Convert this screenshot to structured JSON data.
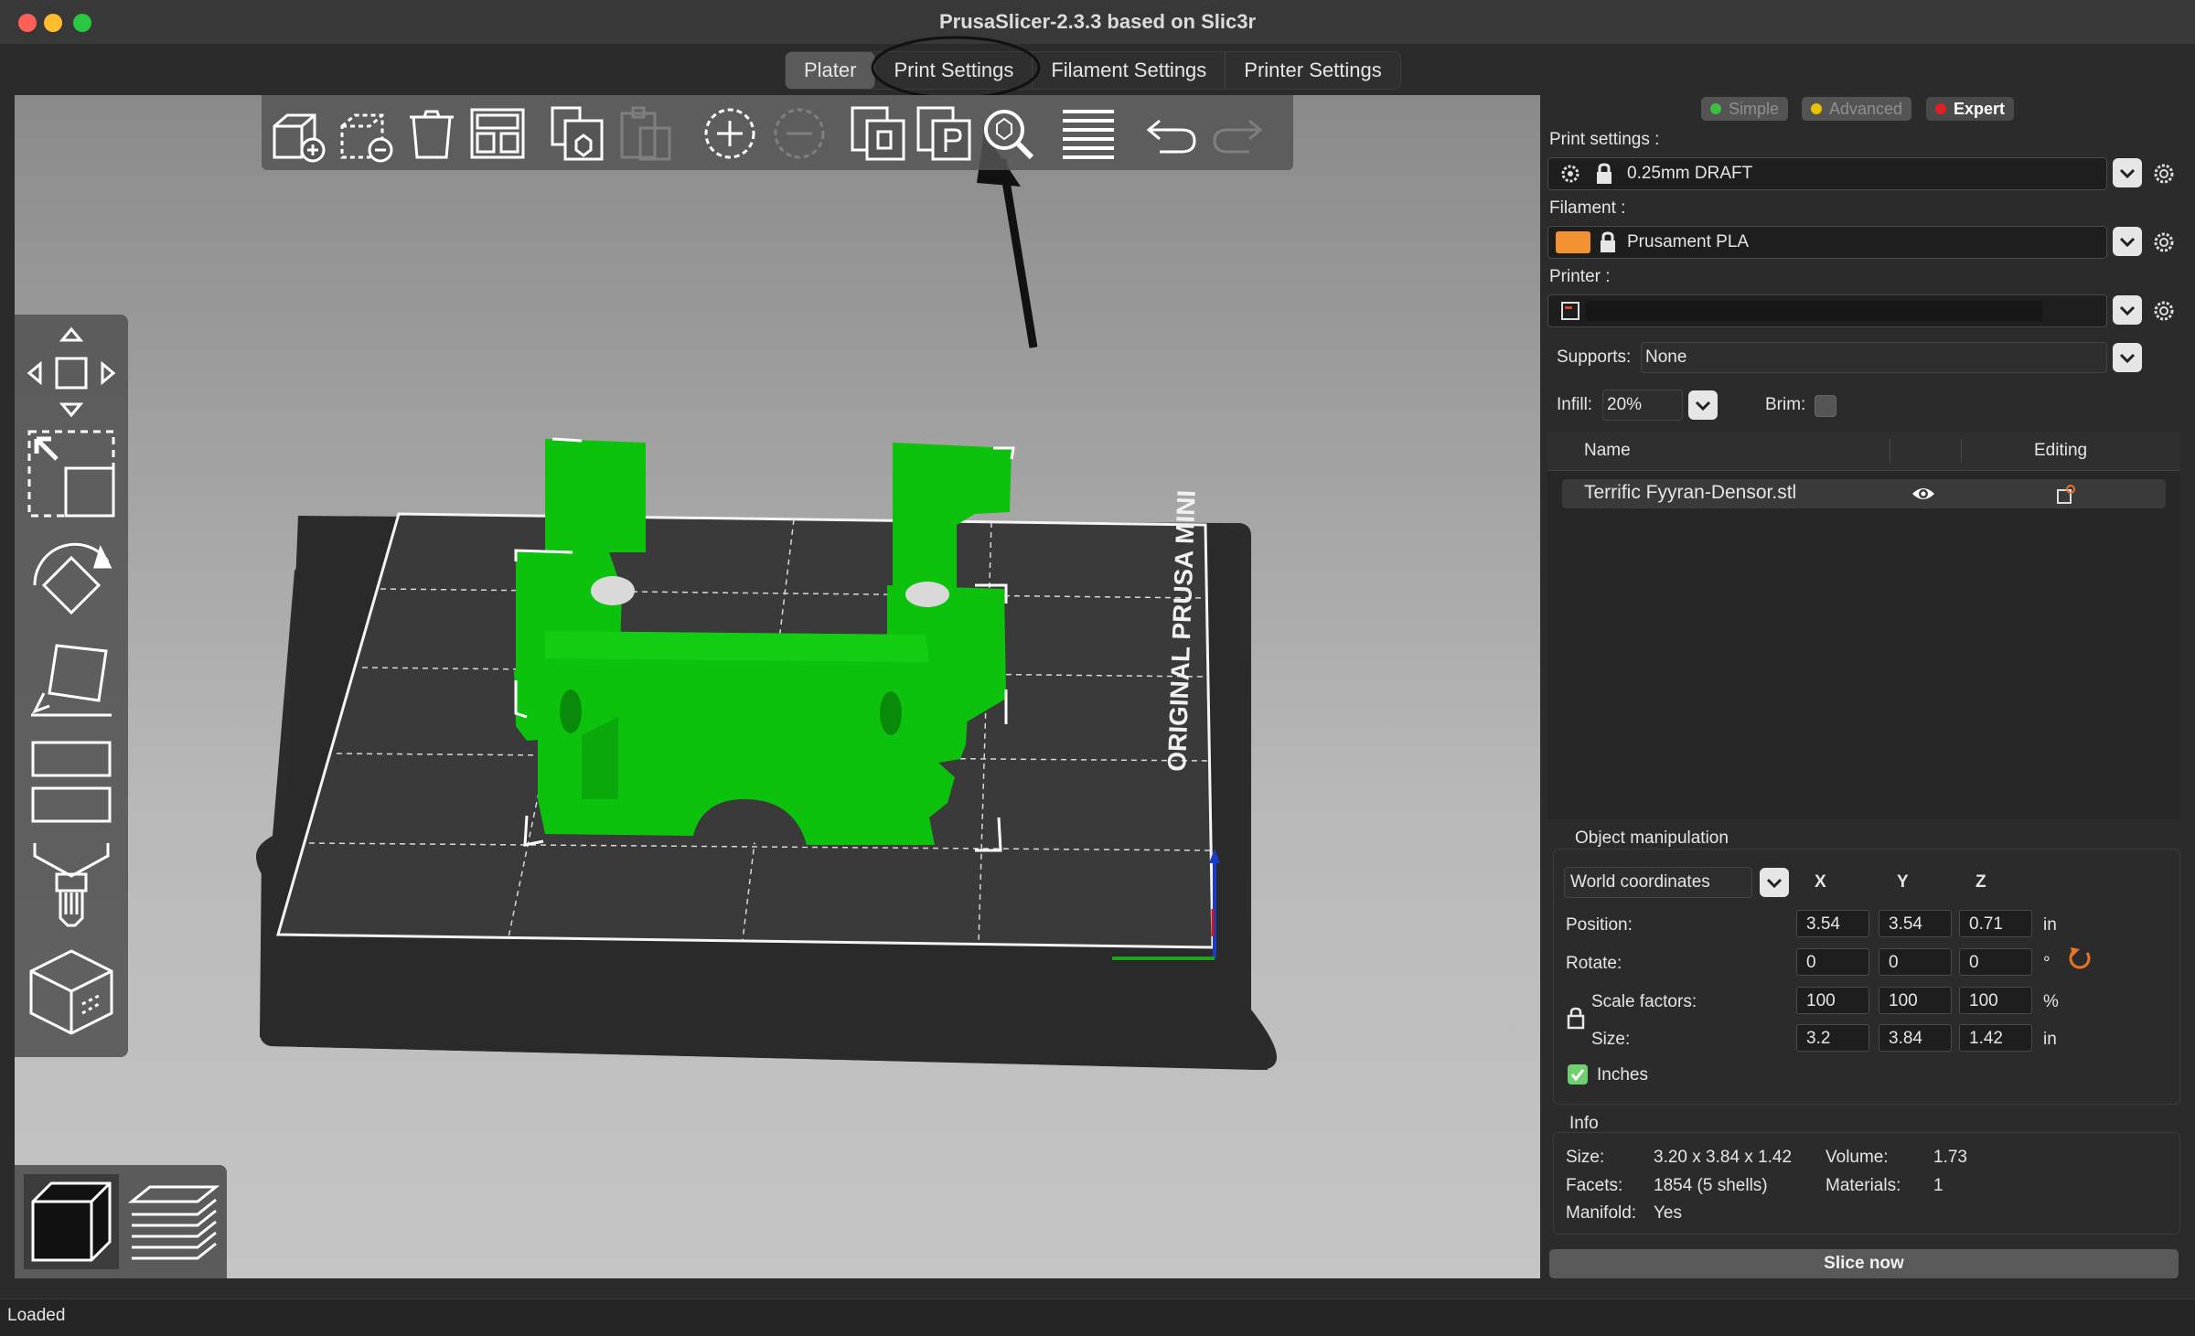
{
  "window": {
    "title": "PrusaSlicer-2.3.3 based on Slic3r",
    "traffic_lights": [
      "#fe5f57",
      "#febc2e",
      "#28c840"
    ]
  },
  "tabs": [
    {
      "label": "Plater",
      "active": true
    },
    {
      "label": "Print Settings",
      "active": false,
      "highlighted": true
    },
    {
      "label": "Filament Settings",
      "active": false
    },
    {
      "label": "Printer Settings",
      "active": false
    }
  ],
  "toolbar": {
    "icons": [
      "add-object-icon",
      "delete-object-icon",
      "delete-all-icon",
      "arrange-icon",
      "copy-icon",
      "paste-icon",
      "add-instance-icon",
      "remove-instance-icon",
      "split-objects-icon",
      "split-parts-icon",
      "search-icon",
      "layer-editing-icon",
      "undo-icon",
      "redo-icon"
    ]
  },
  "left_tools": [
    "move-icon",
    "scale-icon",
    "rotate-icon",
    "place-on-face-icon",
    "cut-icon",
    "paint-supports-icon",
    "seam-painting-icon"
  ],
  "view_tools": [
    "3d-view-icon",
    "preview-layers-icon"
  ],
  "bed": {
    "label": "ORIGINAL PRUSA MINI"
  },
  "modes": [
    {
      "label": "Simple",
      "color": "#3fbf3f",
      "active": false
    },
    {
      "label": "Advanced",
      "color": "#e8c400",
      "active": false
    },
    {
      "label": "Expert",
      "color": "#e02020",
      "active": true
    }
  ],
  "print_settings": {
    "label": "Print settings :",
    "value": "0.25mm DRAFT"
  },
  "filament": {
    "label": "Filament :",
    "value": "Prusament PLA",
    "swatch": "#f39233"
  },
  "printer": {
    "label": "Printer :",
    "value": ""
  },
  "supports": {
    "label": "Supports:",
    "value": "None"
  },
  "infill": {
    "label": "Infill:",
    "value": "20%"
  },
  "brim": {
    "label": "Brim:",
    "checked": false
  },
  "object_list": {
    "headers": {
      "name": "Name",
      "editing": "Editing"
    },
    "items": [
      {
        "name": "Terrific Fyyran-Densor.stl"
      }
    ]
  },
  "manipulation": {
    "title": "Object manipulation",
    "coordinates": "World coordinates",
    "axes": [
      "X",
      "Y",
      "Z"
    ],
    "rows": [
      {
        "label": "Position:",
        "values": [
          "3.54",
          "3.54",
          "0.71"
        ],
        "unit": "in"
      },
      {
        "label": "Rotate:",
        "values": [
          "0",
          "0",
          "0"
        ],
        "unit": "°"
      },
      {
        "label": "Scale factors:",
        "values": [
          "100",
          "100",
          "100"
        ],
        "unit": "%"
      },
      {
        "label": "Size:",
        "values": [
          "3.2",
          "3.84",
          "1.42"
        ],
        "unit": "in"
      }
    ],
    "inches": {
      "label": "Inches",
      "checked": true
    }
  },
  "info": {
    "title": "Info",
    "size": {
      "label": "Size:",
      "value": "3.20 x 3.84 x 1.42"
    },
    "volume": {
      "label": "Volume:",
      "value": "1.73"
    },
    "facets": {
      "label": "Facets:",
      "value": "1854 (5 shells)"
    },
    "materials": {
      "label": "Materials:",
      "value": "1"
    },
    "manifold": {
      "label": "Manifold:",
      "value": "Yes"
    }
  },
  "slice_button": "Slice now",
  "status": "Loaded",
  "colors": {
    "accent": "#3cc83c",
    "model": "#0cc20c",
    "reset": "#e8742a"
  }
}
